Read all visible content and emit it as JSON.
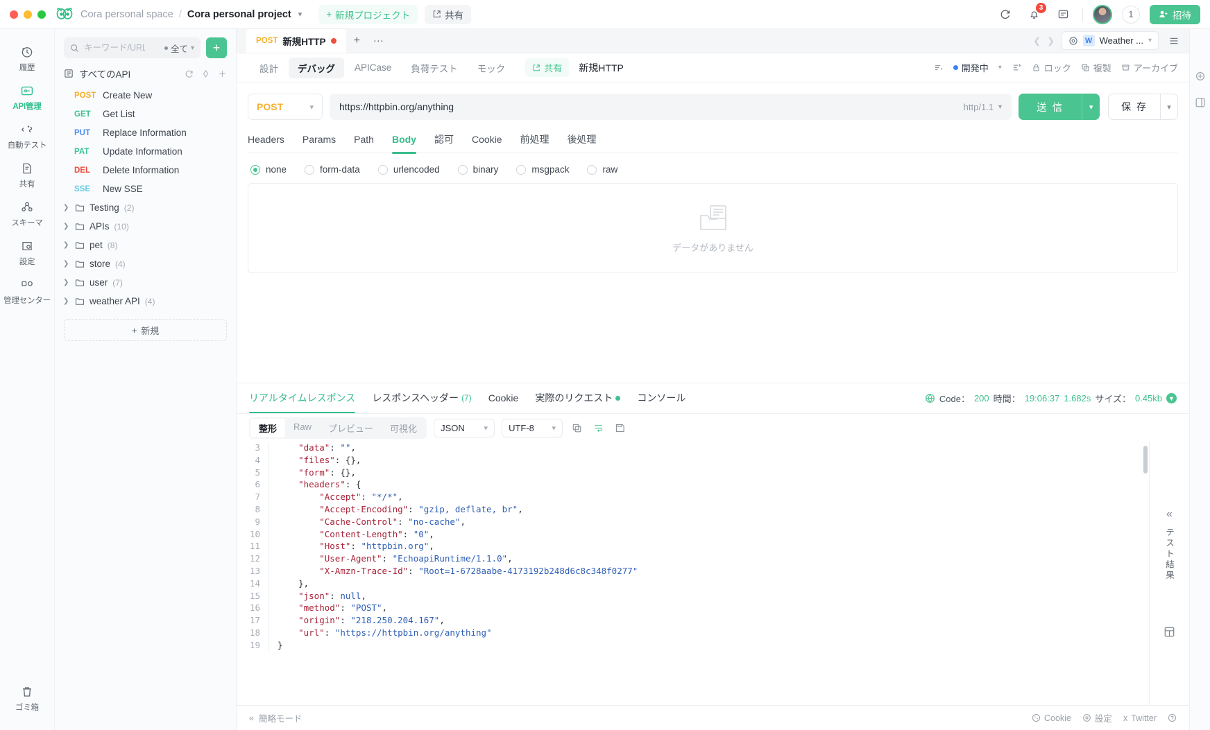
{
  "titlebar": {
    "space": "Cora personal space",
    "separator": "/",
    "project": "Cora personal project",
    "new_project": "新規プロジェクト",
    "share": "共有",
    "notification_count": "3",
    "user_count": "1",
    "invite": "招待"
  },
  "rail": {
    "items": [
      {
        "label": "履歴",
        "icon": "history-icon"
      },
      {
        "label": "API管理",
        "icon": "api-icon"
      },
      {
        "label": "自動テスト",
        "icon": "auto-test-icon"
      },
      {
        "label": "共有",
        "icon": "share-doc-icon"
      },
      {
        "label": "スキーマ",
        "icon": "schema-icon"
      },
      {
        "label": "設定",
        "icon": "settings-icon"
      },
      {
        "label": "管理センター",
        "icon": "admin-icon"
      }
    ],
    "active_index": 1,
    "trash": "ゴミ箱"
  },
  "sidebar": {
    "search_placeholder": "キーワード/URL",
    "filter_label": "全て",
    "add_label": "+",
    "all_api": "すべてのAPI",
    "apis": [
      {
        "method": "POST",
        "name": "Create New",
        "cls": "post"
      },
      {
        "method": "GET",
        "name": "Get List",
        "cls": "get"
      },
      {
        "method": "PUT",
        "name": "Replace Information",
        "cls": "put"
      },
      {
        "method": "PAT",
        "name": "Update Information",
        "cls": "pat"
      },
      {
        "method": "DEL",
        "name": "Delete Information",
        "cls": "del"
      },
      {
        "method": "SSE",
        "name": "New SSE",
        "cls": "sse"
      }
    ],
    "folders": [
      {
        "name": "Testing",
        "count": "(2)"
      },
      {
        "name": "APIs",
        "count": "(10)"
      },
      {
        "name": "pet",
        "count": "(8)"
      },
      {
        "name": "store",
        "count": "(4)"
      },
      {
        "name": "user",
        "count": "(7)"
      },
      {
        "name": "weather API",
        "count": "(4)"
      }
    ],
    "new_button": "新規"
  },
  "tabstrip": {
    "tab_method": "POST",
    "tab_name": "新規HTTP",
    "plus": "+",
    "dots": "···",
    "env_name": "Weather ...",
    "env_badge": "W"
  },
  "viewtabs": {
    "items": [
      "設計",
      "デバッグ",
      "APICase",
      "負荷テスト",
      "モック"
    ],
    "active": "デバッグ",
    "share": "共有",
    "title": "新規HTTP",
    "status": "開発中",
    "lock": "ロック",
    "duplicate": "複製",
    "archive": "アーカイブ"
  },
  "request": {
    "method": "POST",
    "url": "https://httpbin.org/anything",
    "http_version": "http/1.1",
    "send": "送 信",
    "save": "保 存",
    "subtabs": [
      "Headers",
      "Params",
      "Path",
      "Body",
      "認可",
      "Cookie",
      "前処理",
      "後処理"
    ],
    "active_subtab": "Body",
    "body_types": [
      "none",
      "form-data",
      "urlencoded",
      "binary",
      "msgpack",
      "raw"
    ],
    "selected_body_type": "none",
    "empty_text": "データがありません"
  },
  "response": {
    "tabs": [
      {
        "label": "リアルタイムレスポンス",
        "count": "",
        "dot": false
      },
      {
        "label": "レスポンスヘッダー",
        "count": "(7)",
        "dot": false
      },
      {
        "label": "Cookie",
        "count": "",
        "dot": false
      },
      {
        "label": "実際のリクエスト",
        "count": "",
        "dot": true
      },
      {
        "label": "コンソール",
        "count": "",
        "dot": false
      }
    ],
    "active_tab": "リアルタイムレスポンス",
    "meta": {
      "code_label": "Code：",
      "code_value": "200",
      "time_label": "時間：",
      "time_value": "19:06:37",
      "duration": "1.682s",
      "size_label": "サイズ：",
      "size_value": "0.45kb"
    },
    "controls": {
      "segments": [
        "整形",
        "Raw",
        "プレビュー",
        "可視化"
      ],
      "active_segment": "整形",
      "format": "JSON",
      "encoding": "UTF-8"
    },
    "sidebar_label": "テスト結果",
    "code_lines": [
      {
        "n": "3",
        "indent": 1,
        "parts": [
          {
            "t": "\"data\"",
            "c": "k"
          },
          {
            "t": ": ",
            "c": "p"
          },
          {
            "t": "\"\"",
            "c": "s"
          },
          {
            "t": ",",
            "c": "p"
          }
        ]
      },
      {
        "n": "4",
        "indent": 1,
        "parts": [
          {
            "t": "\"files\"",
            "c": "k"
          },
          {
            "t": ": {},",
            "c": "p"
          }
        ]
      },
      {
        "n": "5",
        "indent": 1,
        "parts": [
          {
            "t": "\"form\"",
            "c": "k"
          },
          {
            "t": ": {},",
            "c": "p"
          }
        ]
      },
      {
        "n": "6",
        "indent": 1,
        "parts": [
          {
            "t": "\"headers\"",
            "c": "k"
          },
          {
            "t": ": {",
            "c": "p"
          }
        ]
      },
      {
        "n": "7",
        "indent": 2,
        "parts": [
          {
            "t": "\"Accept\"",
            "c": "k"
          },
          {
            "t": ": ",
            "c": "p"
          },
          {
            "t": "\"*/*\"",
            "c": "s"
          },
          {
            "t": ",",
            "c": "p"
          }
        ]
      },
      {
        "n": "8",
        "indent": 2,
        "parts": [
          {
            "t": "\"Accept-Encoding\"",
            "c": "k"
          },
          {
            "t": ": ",
            "c": "p"
          },
          {
            "t": "\"gzip, deflate, br\"",
            "c": "s"
          },
          {
            "t": ",",
            "c": "p"
          }
        ]
      },
      {
        "n": "9",
        "indent": 2,
        "parts": [
          {
            "t": "\"Cache-Control\"",
            "c": "k"
          },
          {
            "t": ": ",
            "c": "p"
          },
          {
            "t": "\"no-cache\"",
            "c": "s"
          },
          {
            "t": ",",
            "c": "p"
          }
        ]
      },
      {
        "n": "10",
        "indent": 2,
        "parts": [
          {
            "t": "\"Content-Length\"",
            "c": "k"
          },
          {
            "t": ": ",
            "c": "p"
          },
          {
            "t": "\"0\"",
            "c": "s"
          },
          {
            "t": ",",
            "c": "p"
          }
        ]
      },
      {
        "n": "11",
        "indent": 2,
        "parts": [
          {
            "t": "\"Host\"",
            "c": "k"
          },
          {
            "t": ": ",
            "c": "p"
          },
          {
            "t": "\"httpbin.org\"",
            "c": "s"
          },
          {
            "t": ",",
            "c": "p"
          }
        ]
      },
      {
        "n": "12",
        "indent": 2,
        "parts": [
          {
            "t": "\"User-Agent\"",
            "c": "k"
          },
          {
            "t": ": ",
            "c": "p"
          },
          {
            "t": "\"EchoapiRuntime/1.1.0\"",
            "c": "s"
          },
          {
            "t": ",",
            "c": "p"
          }
        ]
      },
      {
        "n": "13",
        "indent": 2,
        "parts": [
          {
            "t": "\"X-Amzn-Trace-Id\"",
            "c": "k"
          },
          {
            "t": ": ",
            "c": "p"
          },
          {
            "t": "\"Root=1-6728aabe-4173192b248d6c8c348f0277\"",
            "c": "s"
          }
        ]
      },
      {
        "n": "14",
        "indent": 1,
        "parts": [
          {
            "t": "},",
            "c": "p"
          }
        ]
      },
      {
        "n": "15",
        "indent": 1,
        "parts": [
          {
            "t": "\"json\"",
            "c": "k"
          },
          {
            "t": ": ",
            "c": "p"
          },
          {
            "t": "null",
            "c": "nl"
          },
          {
            "t": ",",
            "c": "p"
          }
        ]
      },
      {
        "n": "16",
        "indent": 1,
        "parts": [
          {
            "t": "\"method\"",
            "c": "k"
          },
          {
            "t": ": ",
            "c": "p"
          },
          {
            "t": "\"POST\"",
            "c": "s"
          },
          {
            "t": ",",
            "c": "p"
          }
        ]
      },
      {
        "n": "17",
        "indent": 1,
        "parts": [
          {
            "t": "\"origin\"",
            "c": "k"
          },
          {
            "t": ": ",
            "c": "p"
          },
          {
            "t": "\"218.250.204.167\"",
            "c": "s"
          },
          {
            "t": ",",
            "c": "p"
          }
        ]
      },
      {
        "n": "18",
        "indent": 1,
        "parts": [
          {
            "t": "\"url\"",
            "c": "k"
          },
          {
            "t": ": ",
            "c": "p"
          },
          {
            "t": "\"https://httpbin.org/anything\"",
            "c": "s"
          }
        ]
      },
      {
        "n": "19",
        "indent": 0,
        "parts": [
          {
            "t": "}",
            "c": "p"
          }
        ]
      }
    ]
  },
  "footer": {
    "simple_mode": "簡略モード",
    "cookie": "Cookie",
    "settings": "設定",
    "twitter": "Twitter"
  },
  "colors": {
    "accent": "#4ac490",
    "post": "#f5b02e",
    "danger": "#f5483b"
  }
}
